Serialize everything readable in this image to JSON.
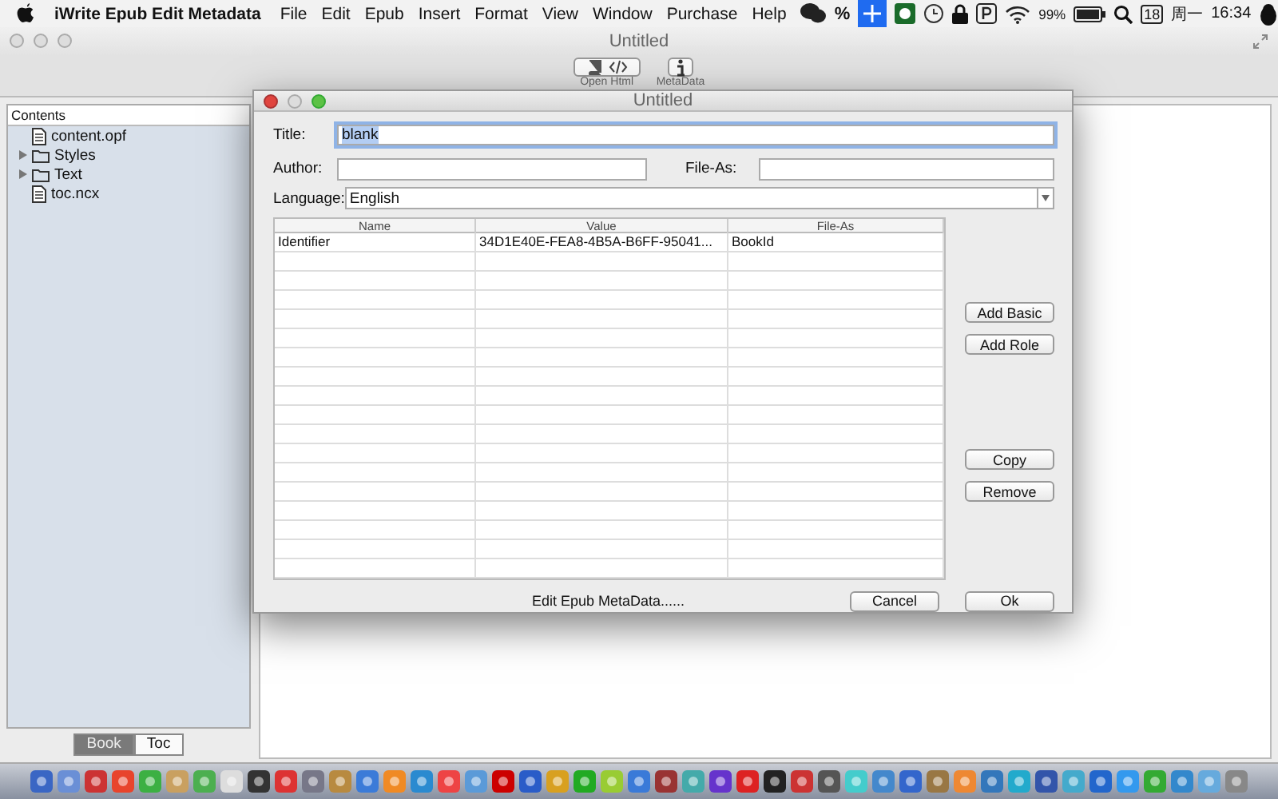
{
  "menubar": {
    "app_name": "iWrite Epub Edit Metadata",
    "menus": [
      "File",
      "Edit",
      "Epub",
      "Insert",
      "Format",
      "View",
      "Window",
      "Purchase",
      "Help"
    ],
    "status": {
      "percent": "%",
      "battery": "99%",
      "date": "18",
      "weekday": "周一",
      "time": "16:34"
    }
  },
  "window": {
    "title": "Untitled",
    "toolbar": [
      {
        "label": "Open Html"
      },
      {
        "label": "MetaData"
      }
    ]
  },
  "sidebar": {
    "header": "Contents",
    "items": [
      {
        "label": "content.opf",
        "kind": "file"
      },
      {
        "label": "Styles",
        "kind": "folder",
        "expanded": false
      },
      {
        "label": "Text",
        "kind": "folder",
        "expanded": false
      },
      {
        "label": "toc.ncx",
        "kind": "file"
      }
    ],
    "tabs": [
      {
        "label": "Book",
        "selected": true
      },
      {
        "label": "Toc",
        "selected": false
      }
    ]
  },
  "dialog": {
    "title": "Untitled",
    "title_label": "Title:",
    "title_value": "blank",
    "author_label": "Author:",
    "file_as_label": "File-As:",
    "language_label": "Language:",
    "language_value": "English",
    "table": {
      "columns": [
        "Name",
        "Value",
        "File-As"
      ],
      "rows": [
        [
          "Identifier",
          "34D1E40E-FEA8-4B5A-B6FF-95041...",
          "BookId"
        ]
      ]
    },
    "side_buttons": [
      {
        "label": "Add Basic"
      },
      {
        "label": "Add Role"
      },
      {
        "label": "Copy"
      },
      {
        "label": "Remove"
      }
    ],
    "status_text": "Edit Epub MetaData......",
    "buttons": [
      {
        "label": "Cancel"
      },
      {
        "label": "Ok"
      }
    ]
  }
}
